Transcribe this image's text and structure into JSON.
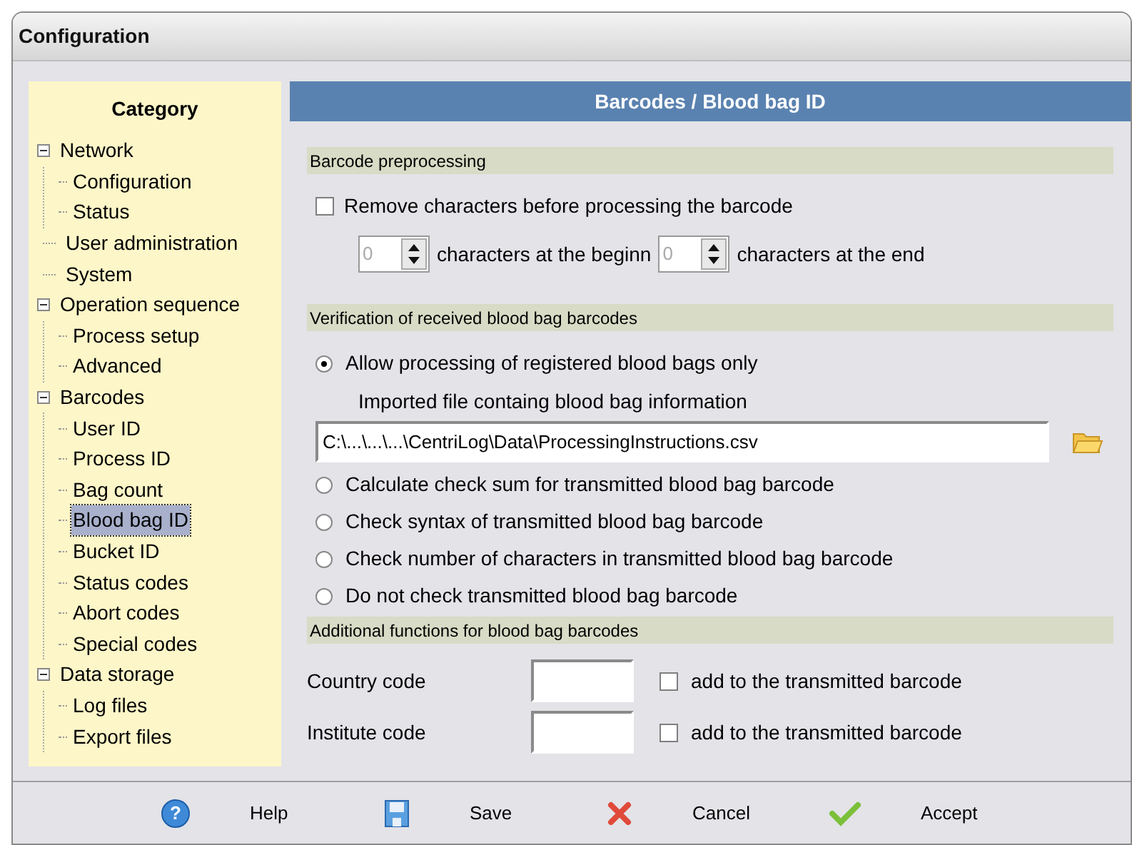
{
  "window": {
    "title": "Configuration"
  },
  "sidebar": {
    "title": "Category",
    "items": [
      {
        "label": "Network",
        "expanded": true,
        "selected": false,
        "children": [
          {
            "label": "Configuration",
            "selected": false
          },
          {
            "label": "Status",
            "selected": false
          }
        ]
      },
      {
        "label": "User administration",
        "selected": false
      },
      {
        "label": "System",
        "selected": false
      },
      {
        "label": "Operation sequence",
        "expanded": true,
        "selected": false,
        "children": [
          {
            "label": "Process setup",
            "selected": false
          },
          {
            "label": "Advanced",
            "selected": false
          }
        ]
      },
      {
        "label": "Barcodes",
        "expanded": true,
        "selected": false,
        "children": [
          {
            "label": "User ID",
            "selected": false
          },
          {
            "label": "Process ID",
            "selected": false
          },
          {
            "label": "Bag count",
            "selected": false
          },
          {
            "label": "Blood bag ID",
            "selected": true
          },
          {
            "label": "Bucket ID",
            "selected": false
          },
          {
            "label": "Status codes",
            "selected": false
          },
          {
            "label": "Abort codes",
            "selected": false
          },
          {
            "label": "Special codes",
            "selected": false
          }
        ]
      },
      {
        "label": "Data storage",
        "expanded": true,
        "selected": false,
        "children": [
          {
            "label": "Log files",
            "selected": false
          },
          {
            "label": "Export files",
            "selected": false
          }
        ]
      }
    ]
  },
  "panel": {
    "title": "Barcodes / Blood bag ID",
    "preprocessing": {
      "heading": "Barcode preprocessing",
      "remove": {
        "label": "Remove characters before processing the barcode",
        "checked": false
      },
      "begin": {
        "value": "0",
        "label": "characters at the beginn"
      },
      "end": {
        "value": "0",
        "label": "characters at the end"
      }
    },
    "verification": {
      "heading": "Verification of received blood bag barcodes",
      "options": [
        {
          "label": "Allow processing of registered blood bags only",
          "selected": true,
          "file_label": "Imported file containg blood bag information",
          "file_value": "C:\\...\\...\\...\\CentriLog\\Data\\ProcessingInstructions.csv"
        },
        {
          "label": "Calculate check sum for transmitted blood bag barcode",
          "selected": false
        },
        {
          "label": "Check syntax of transmitted blood bag barcode",
          "selected": false
        },
        {
          "label": "Check number of characters in transmitted blood bag barcode",
          "selected": false
        },
        {
          "label": "Do not check transmitted blood bag barcode",
          "selected": false
        }
      ]
    },
    "additional": {
      "heading": "Additional functions for blood bag barcodes",
      "rows": [
        {
          "label": "Country code",
          "checkbox": "add to the transmitted barcode",
          "checked": false
        },
        {
          "label": "Institute code",
          "checkbox": "add to the transmitted barcode",
          "checked": false
        }
      ]
    }
  },
  "buttons": [
    {
      "kind": "help",
      "label": "Help",
      "glyph": "?"
    },
    {
      "kind": "save",
      "label": "Save"
    },
    {
      "kind": "cancel",
      "label": "Cancel"
    },
    {
      "kind": "accept",
      "label": "Accept"
    }
  ]
}
